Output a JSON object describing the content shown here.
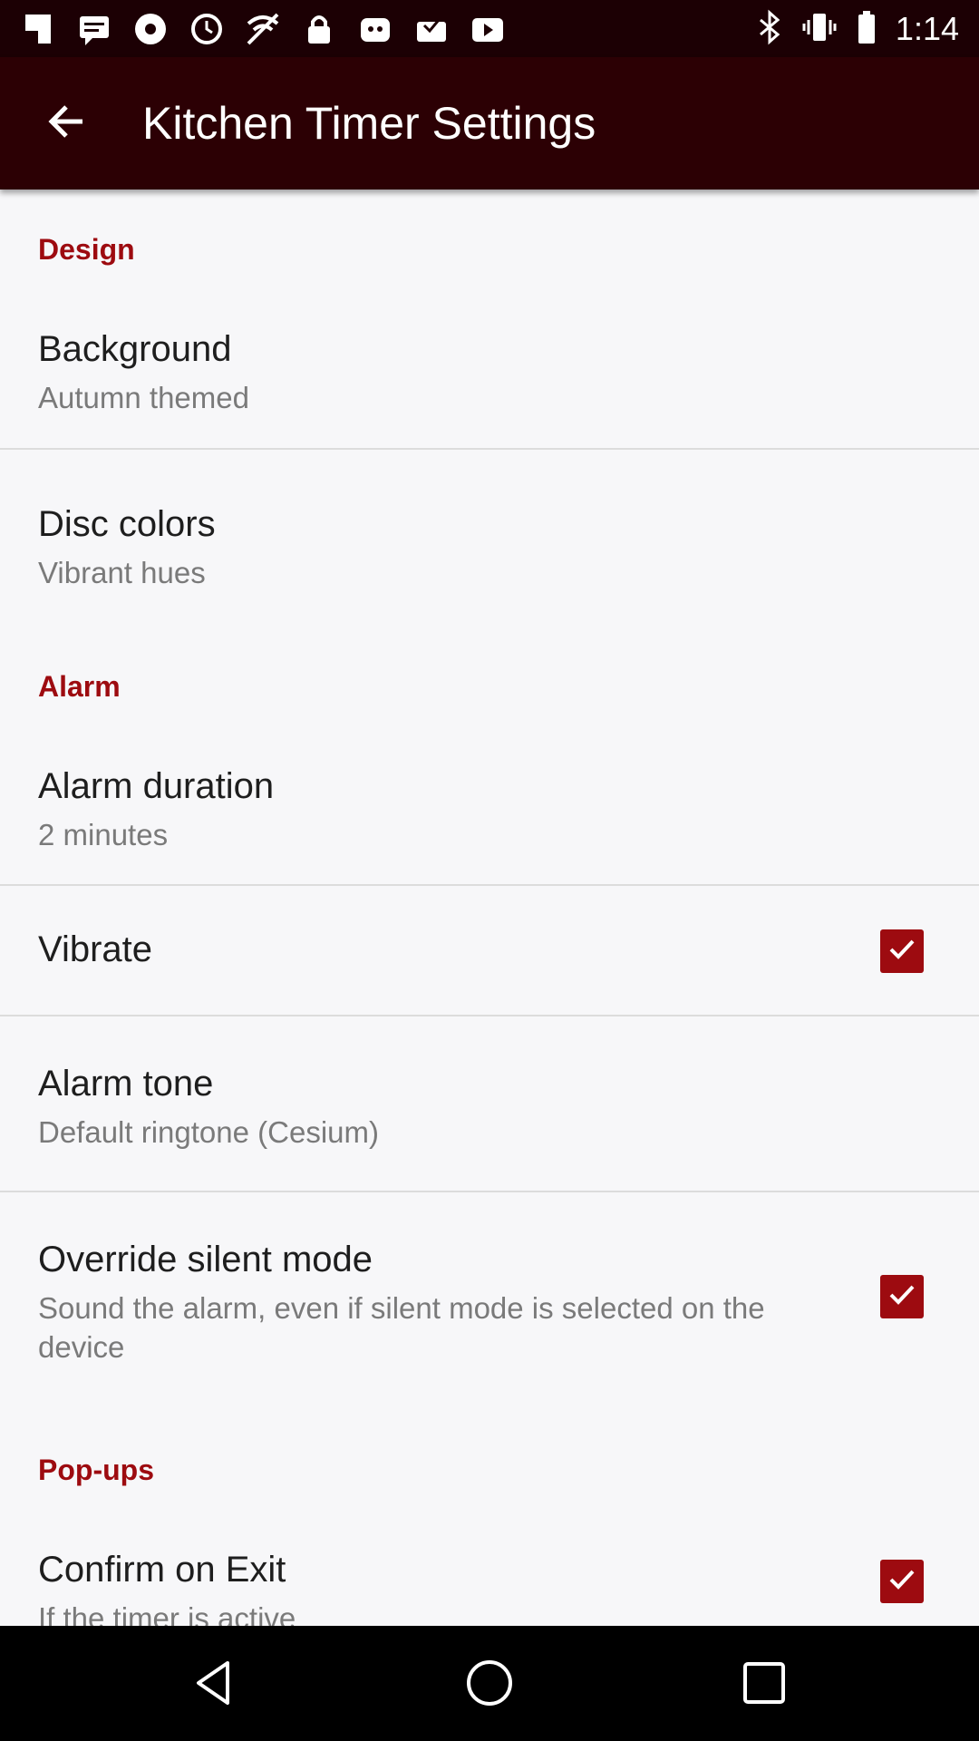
{
  "status_bar": {
    "time": "1:14",
    "icons": [
      "app-icon",
      "message-icon",
      "music-icon",
      "clock-icon",
      "no-wifi-icon",
      "lock-icon",
      "photos-icon",
      "inbox-icon",
      "play-icon",
      "bluetooth-icon",
      "vibrate-icon",
      "battery-icon"
    ]
  },
  "app_bar": {
    "title": "Kitchen Timer Settings",
    "back_icon": "arrow-back-icon"
  },
  "sections": {
    "design": {
      "header": "Design",
      "background": {
        "title": "Background",
        "summary": "Autumn themed"
      },
      "disc_colors": {
        "title": "Disc colors",
        "summary": "Vibrant hues"
      }
    },
    "alarm": {
      "header": "Alarm",
      "duration": {
        "title": "Alarm duration",
        "summary": "2 minutes"
      },
      "vibrate": {
        "title": "Vibrate",
        "checked": true
      },
      "tone": {
        "title": "Alarm tone",
        "summary": "Default ringtone (Cesium)"
      },
      "override": {
        "title": "Override silent mode",
        "summary": "Sound the alarm, even if silent mode is selected on the device",
        "checked": true
      }
    },
    "popups": {
      "header": "Pop-ups",
      "confirm_exit": {
        "title": "Confirm on Exit",
        "summary": "If the timer is active",
        "checked": true
      }
    }
  },
  "nav_bar": {
    "buttons": [
      "back-triangle-icon",
      "home-circle-icon",
      "recents-square-icon"
    ]
  },
  "colors": {
    "status_bar": "#1c0004",
    "app_bar": "#2c0004",
    "accent": "#9d0b10",
    "background": "#f7f7f9"
  }
}
